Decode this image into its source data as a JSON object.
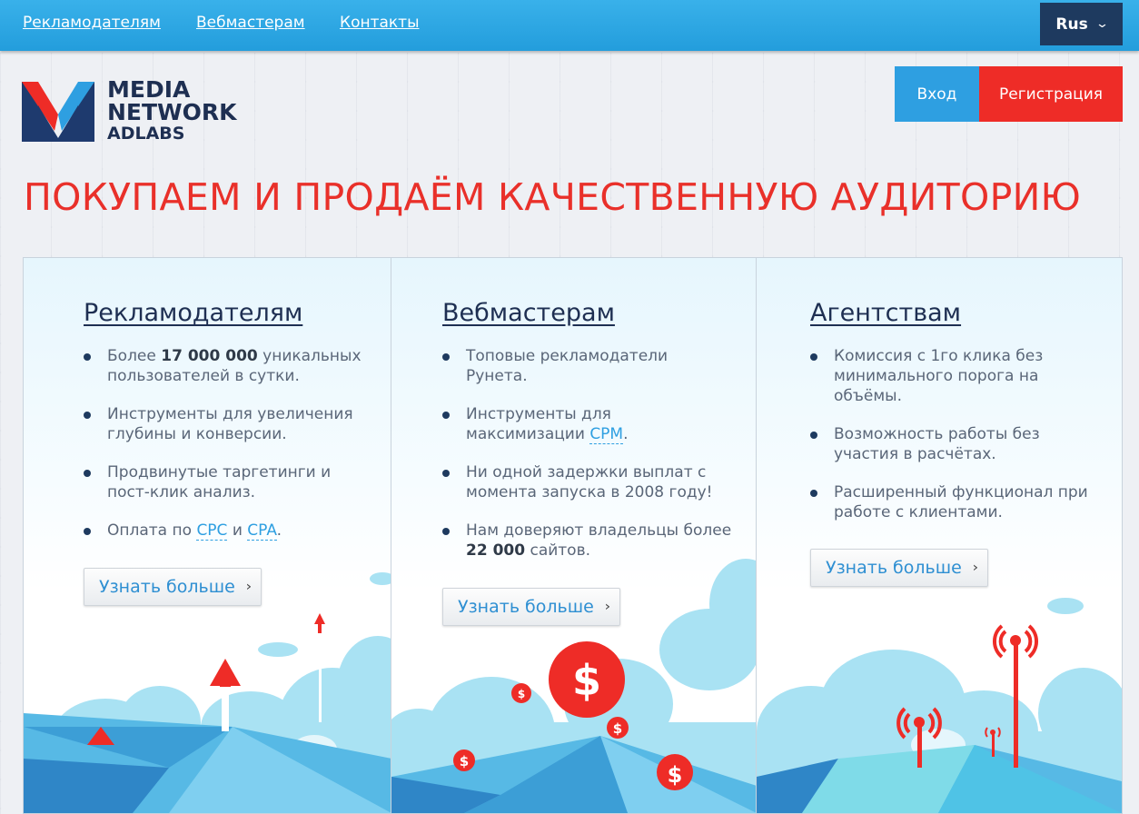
{
  "nav": {
    "advertisers": "Рекламодателям",
    "webmasters": "Вебмастерам",
    "contacts": "Контакты",
    "language": "Rus"
  },
  "logo": {
    "line1": "MEDIA",
    "line2": "NETWORK",
    "line3": "ADLABS"
  },
  "auth": {
    "login": "Вход",
    "register": "Регистрация"
  },
  "headline": "ПОКУПАЕМ И ПРОДАЁМ КАЧЕСТВЕННУЮ АУДИТОРИЮ",
  "panels": [
    {
      "title": "Рекламодателям",
      "items": [
        {
          "pre": "Более ",
          "bold": "17 000 000",
          "post": " уникальных пользователей в сутки."
        },
        {
          "pre": "Инструменты для увеличения глубины и конверсии."
        },
        {
          "pre": "Продвинутые таргетинги и пост-клик анализ."
        },
        {
          "pre": "Оплата по ",
          "link1": "CPC",
          "mid": " и ",
          "link2": "CPA",
          "post": "."
        }
      ],
      "more": "Узнать больше"
    },
    {
      "title": "Вебмастерам",
      "items": [
        {
          "pre": "Топовые рекламодатели Рунета."
        },
        {
          "pre": "Инструменты для максимизации ",
          "link1": "CPM",
          "post": "."
        },
        {
          "pre": "Ни одной задержки выплат с момента запуска в 2008 году!"
        },
        {
          "pre": "Нам доверяют владельцы более ",
          "bold": "22 000",
          "post": " сайтов."
        }
      ],
      "more": "Узнать больше"
    },
    {
      "title": "Агентствам",
      "items": [
        {
          "pre": "Комиссия с 1го клика без минимального порога на объёмы."
        },
        {
          "pre": "Возможность работы без участия в расчётах."
        },
        {
          "pre": "Расширенный функционал при работе с клиентами."
        }
      ],
      "more": "Узнать больше"
    }
  ],
  "colors": {
    "nav_bg": "#2aa5e2",
    "lang_bg": "#1e3a5f",
    "login_bg": "#2e9fe1",
    "register_bg": "#ee2c27",
    "headline": "#e9302a",
    "title": "#1e2f52"
  },
  "icons": {
    "chevron": "chevron-down-icon",
    "more_arrow": "chevron-right-icon"
  }
}
